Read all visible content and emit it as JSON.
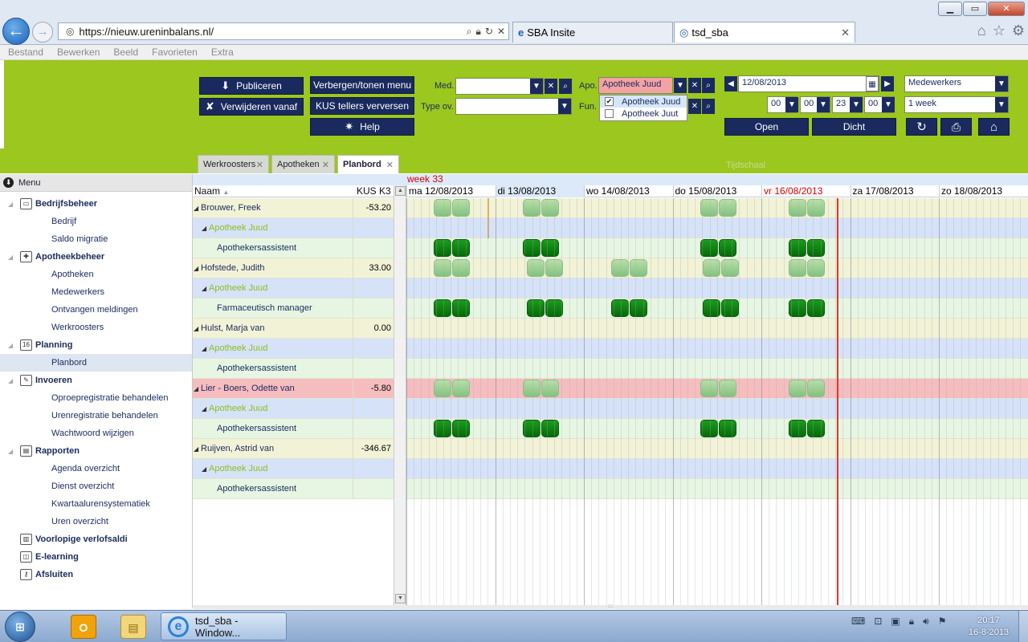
{
  "browser": {
    "url": "https://nieuw.ureninbalans.nl/",
    "tabs": [
      {
        "label": "SBA Insite"
      },
      {
        "label": "tsd_sba"
      }
    ],
    "menu": [
      "Bestand",
      "Bewerken",
      "Beeld",
      "Favorieten",
      "Extra"
    ],
    "window_buttons": {
      "minimize": "▁",
      "restore": "▭",
      "close": "✕"
    }
  },
  "toolbar": {
    "publiceren": "Publiceren",
    "verwijderen": "Verwijderen vanaf",
    "verbergen": "Verbergen/tonen menu",
    "kus": "KUS tellers verversen",
    "help": "Help",
    "med_label": "Med.",
    "med_value": "",
    "typeov_label": "Type ov.",
    "typeov_value": "",
    "apo_label": "Apo.",
    "apo_value": "Apotheek Juud",
    "fun_label": "Fun.",
    "apo_options": [
      {
        "label": "Apotheek Juud",
        "checked": true
      },
      {
        "label": "Apotheek Juut",
        "checked": false
      }
    ],
    "date": "12/08/2013",
    "view_select": "Medewerkers",
    "tijdschaal_label": "Tijdschaal",
    "time_from_h": "00",
    "time_from_m": "00",
    "time_to_h": "23",
    "time_to_m": "00",
    "period_select": "1 week",
    "open": "Open",
    "dicht": "Dicht"
  },
  "app_tabs": [
    "Werkroosters",
    "Apotheken",
    "Planbord"
  ],
  "sidebar": {
    "header": "Menu",
    "items": [
      {
        "label": "Bedrijfsbeheer",
        "level": 0,
        "icon": "folder-icon"
      },
      {
        "label": "Bedrijf",
        "level": 1
      },
      {
        "label": "Saldo migratie",
        "level": 1
      },
      {
        "label": "Apotheekbeheer",
        "level": 0,
        "icon": "pharmacy-icon"
      },
      {
        "label": "Apotheken",
        "level": 1
      },
      {
        "label": "Medewerkers",
        "level": 1
      },
      {
        "label": "Ontvangen meldingen",
        "level": 1
      },
      {
        "label": "Werkroosters",
        "level": 1
      },
      {
        "label": "Planning",
        "level": 0,
        "icon": "calendar-icon"
      },
      {
        "label": "Planbord",
        "level": 1,
        "active": true
      },
      {
        "label": "Invoeren",
        "level": 0,
        "icon": "pencil-icon"
      },
      {
        "label": "Oproepregistratie behandelen",
        "level": 1
      },
      {
        "label": "Urenregistratie behandelen",
        "level": 1
      },
      {
        "label": "Wachtwoord wijzigen",
        "level": 1
      },
      {
        "label": "Rapporten",
        "level": 0,
        "icon": "report-icon"
      },
      {
        "label": "Agenda overzicht",
        "level": 1
      },
      {
        "label": "Dienst overzicht",
        "level": 1
      },
      {
        "label": "Kwartaalurensystematiek",
        "level": 1
      },
      {
        "label": "Uren overzicht",
        "level": 1
      },
      {
        "label": "Voorlopige verlofsaldi",
        "level": 0,
        "icon": "leave-icon"
      },
      {
        "label": "E-learning",
        "level": 0,
        "icon": "elearning-icon"
      },
      {
        "label": "Afsluiten",
        "level": 0,
        "icon": "key-icon"
      }
    ]
  },
  "planbord": {
    "week": "week 33",
    "col_name": "Naam",
    "col_kus": "KUS K3",
    "days": [
      {
        "label": "ma 12/08/2013"
      },
      {
        "label": "di 13/08/2013",
        "today": true
      },
      {
        "label": "wo 14/08/2013"
      },
      {
        "label": "do 15/08/2013"
      },
      {
        "label": "vr 16/08/2013",
        "red": true
      },
      {
        "label": "za 17/08/2013"
      },
      {
        "label": "zo 18/08/2013"
      }
    ],
    "rows": [
      {
        "type": "person",
        "label": "Brouwer, Freek",
        "kus": "-53.20",
        "shifts": {
          "style": "light",
          "days": [
            0,
            1,
            3,
            4
          ]
        }
      },
      {
        "type": "apo",
        "label": "Apotheek Juud"
      },
      {
        "type": "func",
        "label": "Apothekersassistent",
        "shifts": {
          "style": "dark",
          "days": [
            0,
            1,
            3,
            4
          ]
        }
      },
      {
        "type": "person",
        "label": "Hofstede, Judith",
        "kus": "33.00",
        "shifts": {
          "style": "light",
          "days": [
            0,
            1,
            2,
            3,
            4
          ]
        }
      },
      {
        "type": "apo",
        "label": "Apotheek Juud"
      },
      {
        "type": "func",
        "label": "Farmaceutisch manager",
        "shifts": {
          "style": "dark",
          "days": [
            0,
            1,
            2,
            3,
            4
          ]
        }
      },
      {
        "type": "person",
        "label": "Hulst, Marja van",
        "kus": "0.00"
      },
      {
        "type": "apo",
        "label": "Apotheek Juud"
      },
      {
        "type": "func",
        "label": "Apothekersassistent"
      },
      {
        "type": "alert",
        "label": "Lier - Boers, Odette van",
        "kus": "-5.80",
        "shifts": {
          "style": "light",
          "days": [
            0,
            1,
            3,
            4
          ]
        }
      },
      {
        "type": "apo",
        "label": "Apotheek Juud"
      },
      {
        "type": "func",
        "label": "Apothekersassistent",
        "shifts": {
          "style": "dark",
          "days": [
            0,
            1,
            3,
            4
          ]
        }
      },
      {
        "type": "person",
        "label": "Ruijven, Astrid van",
        "kus": "-346.67"
      },
      {
        "type": "apo",
        "label": "Apotheek Juud"
      },
      {
        "type": "func",
        "label": "Apothekersassistent"
      }
    ]
  },
  "taskbar": {
    "task_label": "tsd_sba - Window...",
    "time": "20:17",
    "date": "16-8-2013"
  },
  "colors": {
    "toolbar_green": "#9bc71e",
    "navy": "#1a2a5e",
    "shift_dark": "#0a7f0c",
    "shift_light": "#9fd296",
    "alert_row": "#f6bdbf",
    "red_accent": "#d80000"
  }
}
